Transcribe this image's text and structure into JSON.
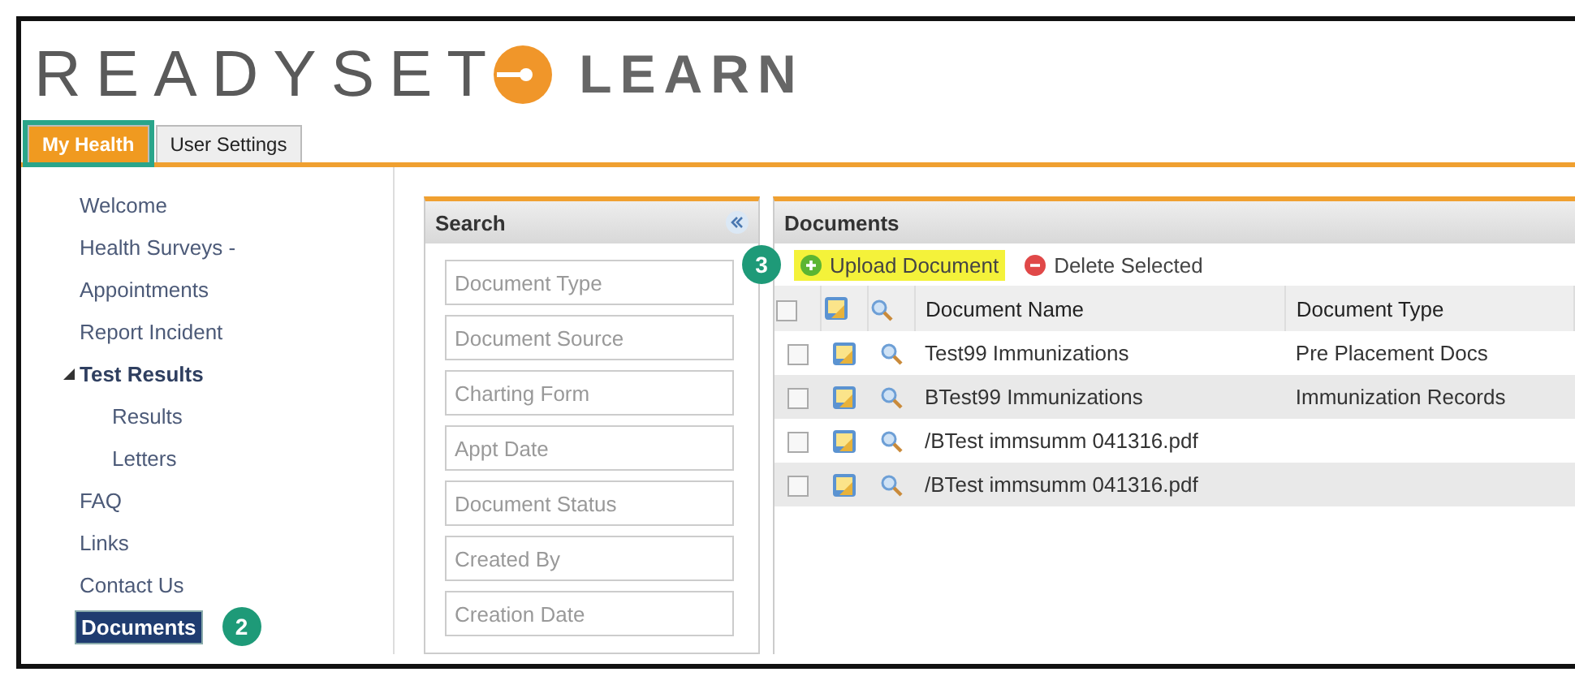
{
  "logo": {
    "word_1": "READYSET",
    "word_2": "LEARN"
  },
  "tabs": [
    {
      "label": "My Health",
      "selected": true,
      "highlighted": true
    },
    {
      "label": "User Settings",
      "selected": false,
      "highlighted": false
    }
  ],
  "sidebar": {
    "items": [
      {
        "label": "Welcome",
        "selected": false
      },
      {
        "label": "Health Surveys -",
        "selected": false
      },
      {
        "label": "Appointments",
        "selected": false
      },
      {
        "label": "Report Incident",
        "selected": false
      },
      {
        "label": "Test Results",
        "selected": false,
        "expanded": true,
        "children": [
          {
            "label": "Results",
            "selected": false
          },
          {
            "label": "Letters",
            "selected": false
          }
        ]
      },
      {
        "label": "FAQ",
        "selected": false
      },
      {
        "label": "Links",
        "selected": false
      },
      {
        "label": "Contact Us",
        "selected": false
      },
      {
        "label": "Documents",
        "selected": true,
        "step": "2"
      }
    ]
  },
  "search_panel": {
    "title": "Search",
    "fields": [
      {
        "placeholder": "Document Type"
      },
      {
        "placeholder": "Document Source"
      },
      {
        "placeholder": "Charting Form"
      },
      {
        "placeholder": "Appt Date"
      },
      {
        "placeholder": "Document Status"
      },
      {
        "placeholder": "Created By"
      },
      {
        "placeholder": "Creation Date"
      }
    ]
  },
  "documents_panel": {
    "title": "Documents",
    "toolbar": [
      {
        "label": "Upload Document",
        "kind": "add",
        "highlighted": true,
        "step": "3"
      },
      {
        "label": "Delete Selected",
        "kind": "delete",
        "highlighted": false
      }
    ],
    "table": {
      "select_all_checked": false,
      "columns": [
        "Document Name",
        "Document Type"
      ],
      "rows": [
        {
          "checked": false,
          "cells": [
            "Test99 Immunizations",
            "Pre Placement Docs"
          ]
        },
        {
          "checked": false,
          "cells": [
            "BTest99 Immunizations",
            "Immunization Records"
          ]
        },
        {
          "checked": false,
          "cells": [
            "/BTest immsumm 041316.pdf"
          ]
        },
        {
          "checked": false,
          "cells": [
            "/BTest immsumm 041316.pdf"
          ]
        }
      ]
    }
  }
}
